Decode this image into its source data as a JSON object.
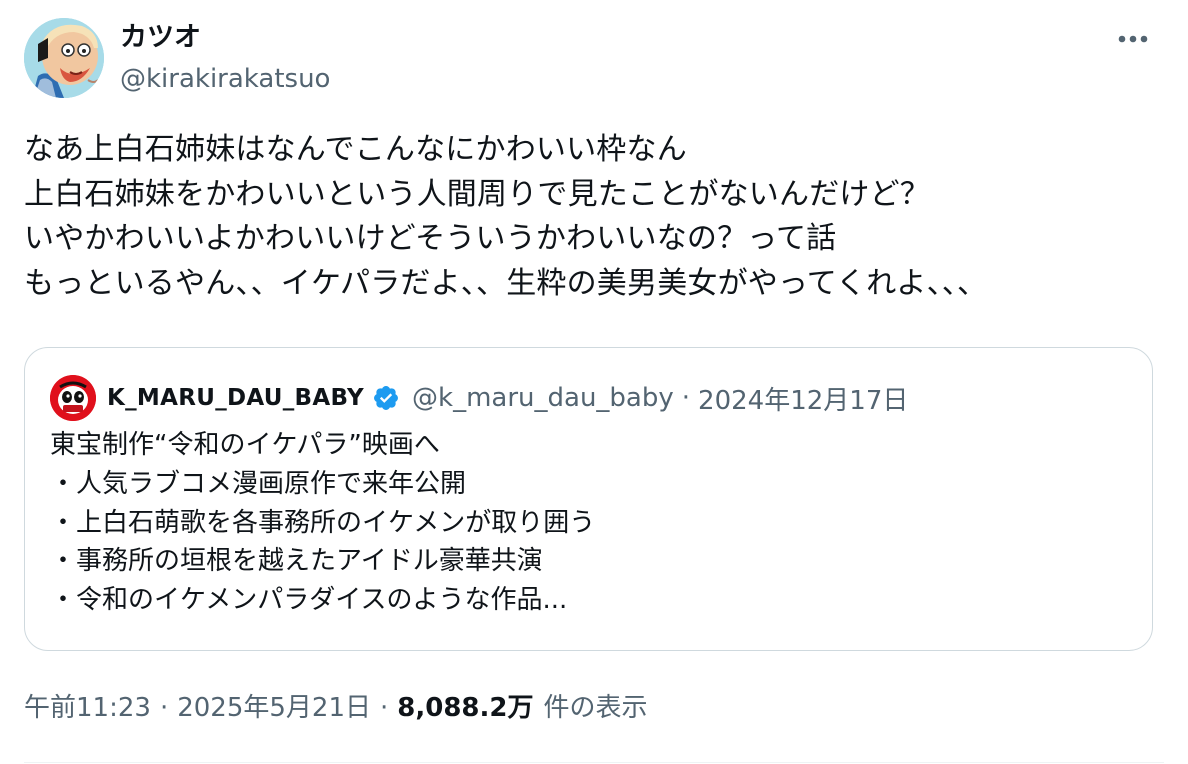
{
  "author": {
    "display_name": "カツオ",
    "handle": "@kirakirakatsuo"
  },
  "icons": {
    "more": "more-horizontal-icon",
    "verified": "verified-badge-icon",
    "verified_color": "#1d9bf0"
  },
  "tweet": {
    "lines": [
      "なあ上白石姉妹はなんでこんなにかわいい枠なん",
      "上白石姉妹をかわいいという人間周りで見たことがないんだけど？",
      "いやかわいいよかわいいけどそういうかわいいなの？って話",
      "もっといるやん、、イケパラだよ、、生粋の美男美女がやってくれよ、、、"
    ]
  },
  "quote": {
    "display_name": "K_MARU_DAU_BABY",
    "handle": "@k_maru_dau_baby",
    "separator": "·",
    "date": "2024年12月17日",
    "lines": [
      "東宝制作“令和のイケパラ”映画へ",
      "・人気ラブコメ漫画原作で来年公開",
      "・上白石萌歌を各事務所のイケメンが取り囲う",
      "・事務所の垣根を越えたアイドル豪華共演",
      "・令和のイケメンパラダイスのような作品..."
    ]
  },
  "meta": {
    "time": "午前11:23",
    "separator": "·",
    "date": "2025年5月21日",
    "views": "8,088.2万",
    "views_label": "件の表示"
  }
}
